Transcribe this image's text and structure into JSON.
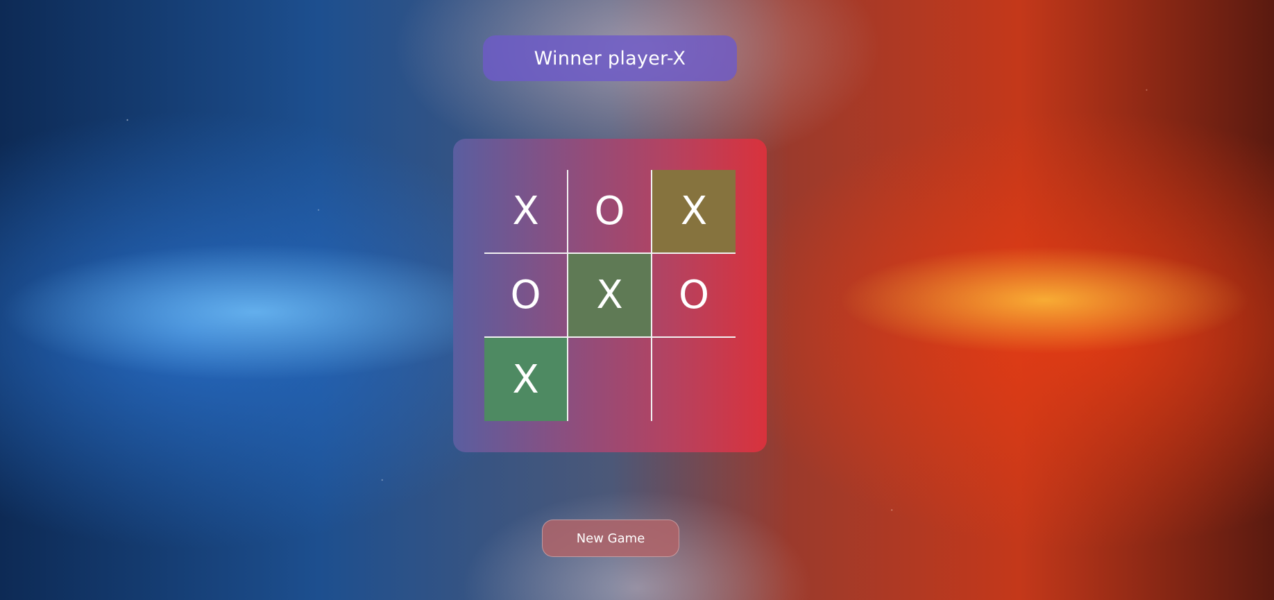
{
  "status": {
    "text": "Winner player-X"
  },
  "board": {
    "cells": [
      {
        "mark": "X",
        "winning": false
      },
      {
        "mark": "O",
        "winning": false
      },
      {
        "mark": "X",
        "winning": true
      },
      {
        "mark": "O",
        "winning": false
      },
      {
        "mark": "X",
        "winning": true
      },
      {
        "mark": "O",
        "winning": false
      },
      {
        "mark": "X",
        "winning": true
      },
      {
        "mark": "",
        "winning": false
      },
      {
        "mark": "",
        "winning": false
      }
    ]
  },
  "actions": {
    "new_game_label": "New Game"
  },
  "colors": {
    "status_pill": "#6e5ac8",
    "board_left": "#5a5ea0",
    "board_right": "#d9323c",
    "win_highlight": "#5f7a55",
    "new_game_button": "#b06469"
  }
}
